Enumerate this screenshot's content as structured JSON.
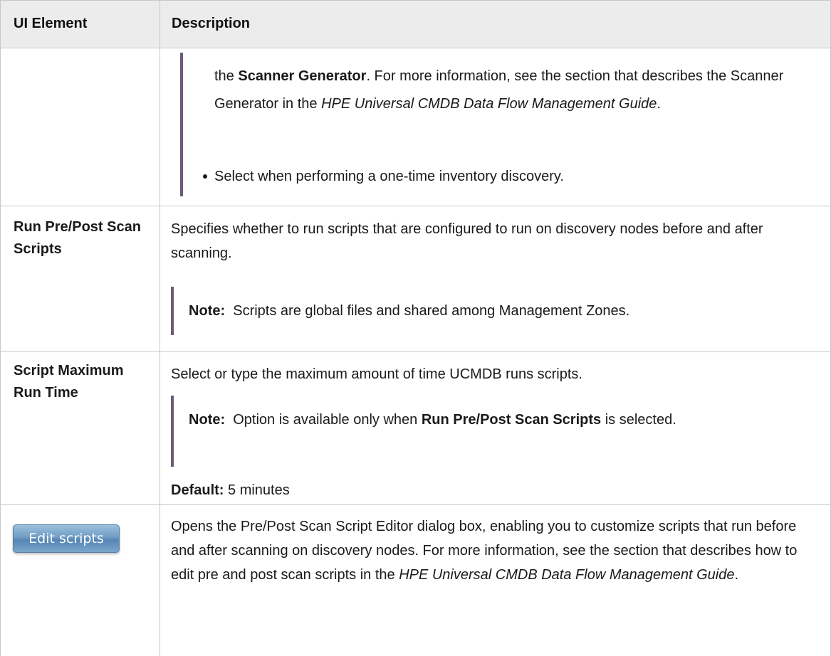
{
  "table": {
    "headers": {
      "ui_element": "UI Element",
      "description": "Description"
    },
    "row_continued": {
      "para_1": {
        "prefix": "the ",
        "bold": "Scanner Generator",
        "mid": ". For more information, see the section that describes the Scanner Generator in the ",
        "italic": "HPE Universal CMDB Data Flow Management Guide",
        "suffix": "."
      },
      "bullet": "Select when performing a one-time inventory discovery."
    },
    "row_run_scripts": {
      "label": "Run Pre/Post Scan Scripts",
      "description": "Specifies whether to run scripts that are configured to run on discovery nodes before and after scanning.",
      "note_label": "Note:",
      "note_text": "Scripts are global files and shared among Management Zones."
    },
    "row_max_run_time": {
      "label": "Script Maximum Run Time",
      "description": "Select or type the maximum amount of time UCMDB runs scripts.",
      "note_label": "Note:",
      "note_prefix": "Option is available only when ",
      "note_bold": "Run Pre/Post Scan Scripts",
      "note_suffix": " is selected.",
      "default_label": "Default:",
      "default_value": "5 minutes"
    },
    "row_edit_scripts": {
      "button_label": "Edit scripts",
      "description_prefix": "Opens the Pre/Post Scan Script Editor dialog box, enabling you to customize scripts that run before and after scanning on discovery nodes. For more information, see the section that describes how to edit pre and post scan scripts in the ",
      "description_italic": "HPE Universal CMDB Data Flow Management Guide",
      "description_suffix": "."
    }
  }
}
